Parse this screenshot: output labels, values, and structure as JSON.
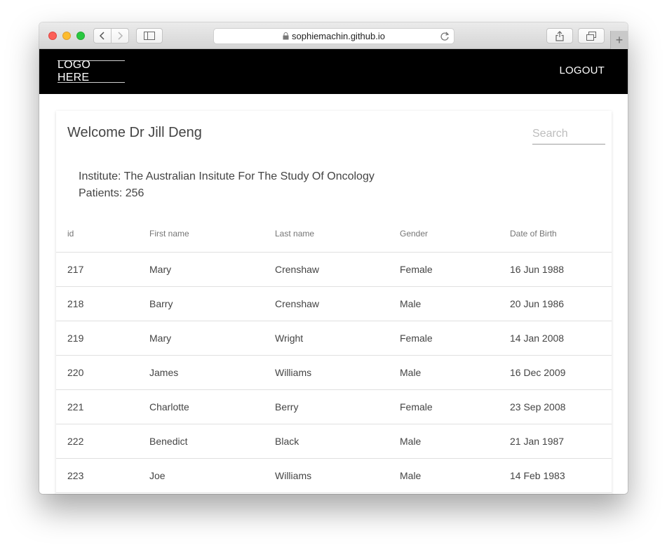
{
  "browser": {
    "url": "sophiemachin.github.io",
    "back_icon": "chevron-left-icon",
    "forward_icon": "chevron-right-icon",
    "new_tab_label": "+"
  },
  "header": {
    "logo": "LOGO HERE",
    "logout": "LOGOUT"
  },
  "main": {
    "welcome": "Welcome Dr Jill Deng",
    "search_placeholder": "Search",
    "institute": "Institute: The Australian Insitute For The Study Of Oncology",
    "patients": "Patients: 256"
  },
  "table": {
    "columns": [
      "id",
      "First name",
      "Last name",
      "Gender",
      "Date of Birth"
    ],
    "rows": [
      [
        "217",
        "Mary",
        "Crenshaw",
        "Female",
        "16 Jun 1988"
      ],
      [
        "218",
        "Barry",
        "Crenshaw",
        "Male",
        "20 Jun 1986"
      ],
      [
        "219",
        "Mary",
        "Wright",
        "Female",
        "14 Jan 2008"
      ],
      [
        "220",
        "James",
        "Williams",
        "Male",
        "16 Dec 2009"
      ],
      [
        "221",
        "Charlotte",
        "Berry",
        "Female",
        "23 Sep 2008"
      ],
      [
        "222",
        "Benedict",
        "Black",
        "Male",
        "21 Jan 1987"
      ],
      [
        "223",
        "Joe",
        "Williams",
        "Male",
        "14 Feb 1983"
      ]
    ]
  },
  "colors": {
    "navbar": "#000000",
    "text": "#444444",
    "close": "#fc5f57",
    "minimize": "#fdbc2e",
    "zoom": "#28c840"
  }
}
